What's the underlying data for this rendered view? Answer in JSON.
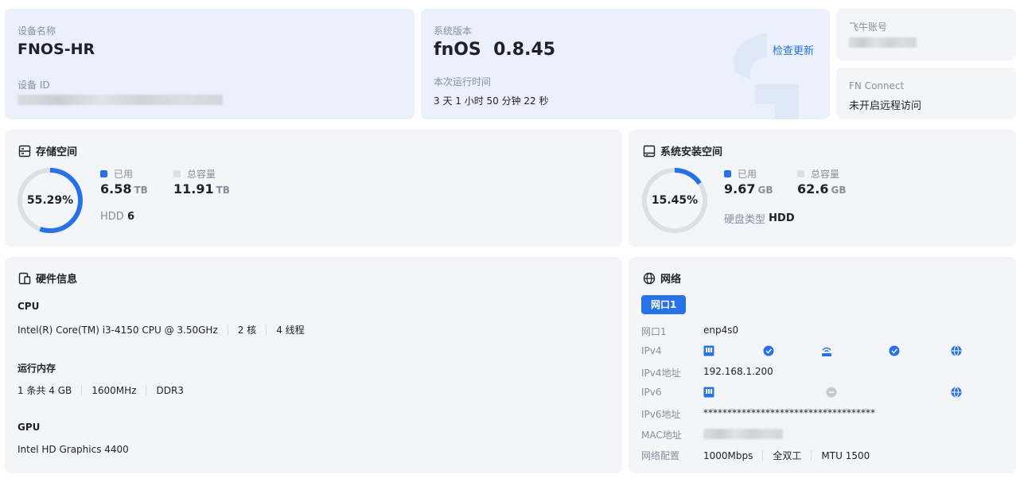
{
  "device": {
    "name_label": "设备名称",
    "name": "FNOS-HR",
    "id_label": "设备 ID"
  },
  "system": {
    "version_label": "系统版本",
    "os": "fnOS",
    "version": "0.8.45",
    "check_update": "检查更新",
    "uptime_label": "本次运行时间",
    "uptime": "3 天 1 小时 50 分钟 22 秒"
  },
  "account": {
    "label": "飞牛账号"
  },
  "fn_connect": {
    "label": "FN Connect",
    "status": "未开启远程访问"
  },
  "storage": {
    "title": "存储空间",
    "percent": "55.29%",
    "percent_value": 55.29,
    "used_label": "已用",
    "used": "6.58",
    "used_unit": "TB",
    "total_label": "总容量",
    "total": "11.91",
    "total_unit": "TB",
    "disk_type_label": "HDD",
    "disk_count": "6"
  },
  "sys_storage": {
    "title": "系统安装空间",
    "percent": "15.45%",
    "percent_value": 15.45,
    "used_label": "已用",
    "used": "9.67",
    "used_unit": "GB",
    "total_label": "总容量",
    "total": "62.6",
    "total_unit": "GB",
    "disk_type_label": "硬盘类型",
    "disk_type": "HDD"
  },
  "hardware": {
    "title": "硬件信息",
    "cpu_label": "CPU",
    "cpu_model": "Intel(R) Core(TM) i3-4150 CPU @ 3.50GHz",
    "cpu_cores": "2 核",
    "cpu_threads": "4 线程",
    "mem_label": "运行内存",
    "mem_size": "1 条共 4 GB",
    "mem_freq": "1600MHz",
    "mem_type": "DDR3",
    "gpu_label": "GPU",
    "gpu_model": "Intel HD Graphics 4400"
  },
  "network": {
    "title": "网络",
    "tab": "网口1",
    "port_label": "网口1",
    "port": "enp4s0",
    "ipv4_label": "IPv4",
    "ipv4_addr_label": "IPv4地址",
    "ipv4_addr": "192.168.1.200",
    "ipv6_label": "IPv6",
    "ipv6_addr_label": "IPv6地址",
    "ipv6_addr": "************************************",
    "mac_label": "MAC地址",
    "config_label": "网络配置",
    "speed": "1000Mbps",
    "duplex": "全双工",
    "mtu": "MTU 1500"
  },
  "colors": {
    "accent": "#2672e6",
    "ring_bg": "#dcdfe4",
    "disabled": "#c4cad3"
  }
}
